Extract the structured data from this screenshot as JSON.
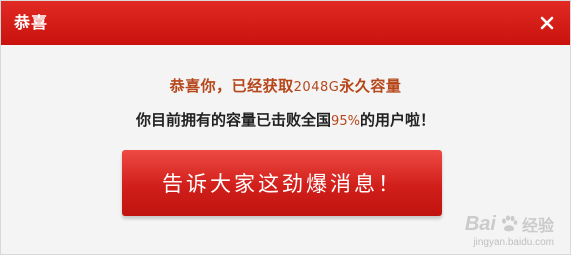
{
  "dialog": {
    "title": "恭喜",
    "close_icon": "close-icon"
  },
  "message": {
    "congrats_prefix": "恭喜你，已经获取",
    "congrats_amount": "2048G",
    "congrats_suffix": "永久容量",
    "info_prefix": "你目前拥有的容量已击败全国",
    "info_percent": "95%",
    "info_suffix": "的用户啦！"
  },
  "share_button": {
    "label": "告诉大家这劲爆消息！"
  },
  "watermark": {
    "brand": "Bai",
    "brand_suffix": "经验",
    "url": "jingyan.baidu.com"
  },
  "colors": {
    "title_bar": "#d41c16",
    "accent_text": "#b6471b",
    "button": "#d11f1a"
  }
}
